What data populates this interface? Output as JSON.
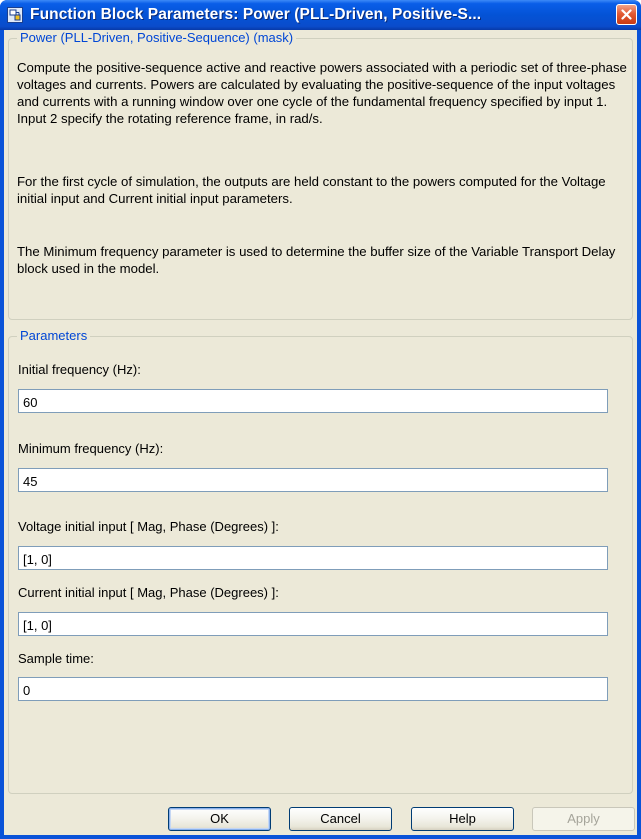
{
  "window": {
    "title": "Function Block Parameters: Power (PLL-Driven, Positive-S..."
  },
  "mask": {
    "group_title": "Power (PLL-Driven, Positive-Sequence) (mask)",
    "paragraphs": [
      "Compute the positive-sequence active and reactive powers associated with a periodic set of three-phase voltages and currents. Powers are calculated by evaluating the positive-sequence of the input voltages and currents with a running window over one cycle of the fundamental frequency specified by input 1. Input 2 specify the rotating reference frame, in rad/s.",
      "For the first cycle of simulation, the outputs are held constant to the powers computed for the Voltage initial input and Current initial input parameters.",
      "The Minimum frequency parameter is used to determine the buffer size of the Variable Transport Delay block used in the model."
    ]
  },
  "parameters": {
    "group_title": "Parameters",
    "fields": [
      {
        "label": "Initial frequency (Hz):",
        "value": "60"
      },
      {
        "label": "Minimum frequency (Hz):",
        "value": "45"
      },
      {
        "label": "Voltage initial input [ Mag, Phase (Degrees) ]:",
        "value": "[1, 0]"
      },
      {
        "label": "Current initial input [ Mag, Phase (Degrees) ]:",
        "value": "[1, 0]"
      },
      {
        "label": "Sample time:",
        "value": "0"
      }
    ]
  },
  "buttons": {
    "ok": "OK",
    "cancel": "Cancel",
    "help": "Help",
    "apply": "Apply"
  },
  "icons": {
    "app": "simulink-block-icon",
    "close": "close-icon"
  },
  "colors": {
    "titlebar": "#0453d6",
    "dialog_background": "#ece9d8",
    "group_title": "#0046d5",
    "close_button": "#e35b35",
    "input_border": "#7f9db9"
  }
}
